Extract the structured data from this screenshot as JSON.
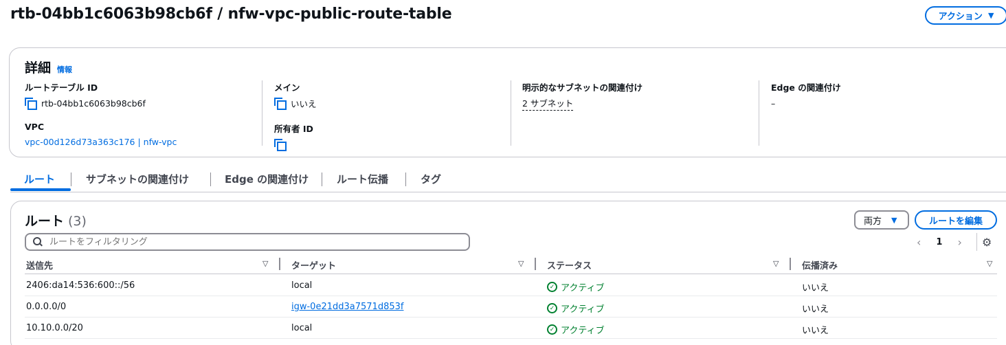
{
  "header": {
    "title": "rtb-04bb1c6063b98cb6f / nfw-vpc-public-route-table",
    "actions_label": "アクション"
  },
  "details": {
    "title": "詳細",
    "info_link": "情報",
    "route_table_id_label": "ルートテーブル ID",
    "route_table_id_value": "rtb-04bb1c6063b98cb6f",
    "vpc_label": "VPC",
    "vpc_value": "vpc-00d126d73a363c176 | nfw-vpc",
    "main_label": "メイン",
    "main_value": "いいえ",
    "owner_label": "所有者 ID",
    "owner_value": "",
    "explicit_subnet_label": "明示的なサブネットの関連付け",
    "explicit_subnet_value": "2 サブネット",
    "edge_label": "Edge の関連付け",
    "edge_value": "–"
  },
  "tabs": [
    {
      "label": "ルート",
      "active": true
    },
    {
      "label": "サブネットの関連付け",
      "active": false
    },
    {
      "label": "Edge の関連付け",
      "active": false
    },
    {
      "label": "ルート伝播",
      "active": false
    },
    {
      "label": "タグ",
      "active": false
    }
  ],
  "routes": {
    "title": "ルート",
    "count": "(3)",
    "direction_select": "両方",
    "edit_button": "ルートを編集",
    "search_placeholder": "ルートをフィルタリング",
    "page": "1",
    "columns": [
      "送信先",
      "ターゲット",
      "ステータス",
      "伝播済み"
    ],
    "rows": [
      {
        "destination": "2406:da14:536:600::/56",
        "target": "local",
        "target_link": false,
        "status": "アクティブ",
        "propagated": "いいえ"
      },
      {
        "destination": "0.0.0.0/0",
        "target": "igw-0e21dd3a7571d853f",
        "target_link": true,
        "status": "アクティブ",
        "propagated": "いいえ"
      },
      {
        "destination": "10.10.0.0/20",
        "target": "local",
        "target_link": false,
        "status": "アクティブ",
        "propagated": "いいえ"
      }
    ]
  },
  "colors": {
    "accent": "#006ce0",
    "success": "#00802f"
  },
  "icons": [
    "copy-icon",
    "search-icon",
    "settings-icon",
    "check-circle-icon",
    "sort-icon",
    "chevron-left-icon",
    "chevron-right-icon",
    "caret-down-icon"
  ]
}
